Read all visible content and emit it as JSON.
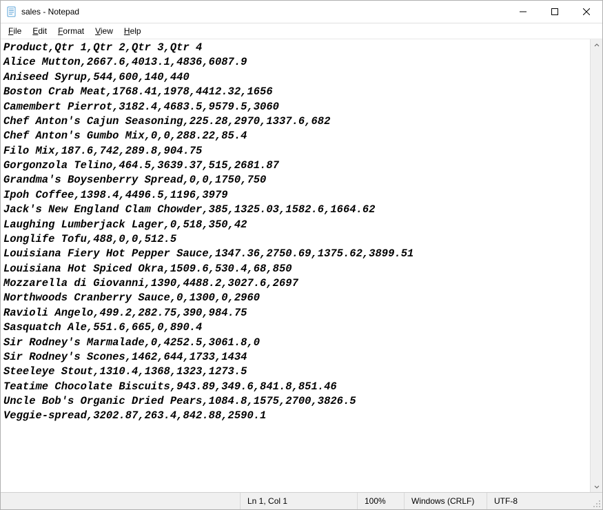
{
  "window": {
    "title": "sales - Notepad"
  },
  "menu": {
    "file": "File",
    "edit": "Edit",
    "format": "Format",
    "view": "View",
    "help": "Help"
  },
  "editor": {
    "lines": [
      "Product,Qtr 1,Qtr 2,Qtr 3,Qtr 4",
      "Alice Mutton,2667.6,4013.1,4836,6087.9",
      "Aniseed Syrup,544,600,140,440",
      "Boston Crab Meat,1768.41,1978,4412.32,1656",
      "Camembert Pierrot,3182.4,4683.5,9579.5,3060",
      "Chef Anton's Cajun Seasoning,225.28,2970,1337.6,682",
      "Chef Anton's Gumbo Mix,0,0,288.22,85.4",
      "Filo Mix,187.6,742,289.8,904.75",
      "Gorgonzola Telino,464.5,3639.37,515,2681.87",
      "Grandma's Boysenberry Spread,0,0,1750,750",
      "Ipoh Coffee,1398.4,4496.5,1196,3979",
      "Jack's New England Clam Chowder,385,1325.03,1582.6,1664.62",
      "Laughing Lumberjack Lager,0,518,350,42",
      "Longlife Tofu,488,0,0,512.5",
      "Louisiana Fiery Hot Pepper Sauce,1347.36,2750.69,1375.62,3899.51",
      "Louisiana Hot Spiced Okra,1509.6,530.4,68,850",
      "Mozzarella di Giovanni,1390,4488.2,3027.6,2697",
      "Northwoods Cranberry Sauce,0,1300,0,2960",
      "Ravioli Angelo,499.2,282.75,390,984.75",
      "Sasquatch Ale,551.6,665,0,890.4",
      "Sir Rodney's Marmalade,0,4252.5,3061.8,0",
      "Sir Rodney's Scones,1462,644,1733,1434",
      "Steeleye Stout,1310.4,1368,1323,1273.5",
      "Teatime Chocolate Biscuits,943.89,349.6,841.8,851.46",
      "Uncle Bob's Organic Dried Pears,1084.8,1575,2700,3826.5",
      "Veggie-spread,3202.87,263.4,842.88,2590.1"
    ]
  },
  "status": {
    "position": "Ln 1, Col 1",
    "zoom": "100%",
    "eol": "Windows (CRLF)",
    "encoding": "UTF-8"
  }
}
